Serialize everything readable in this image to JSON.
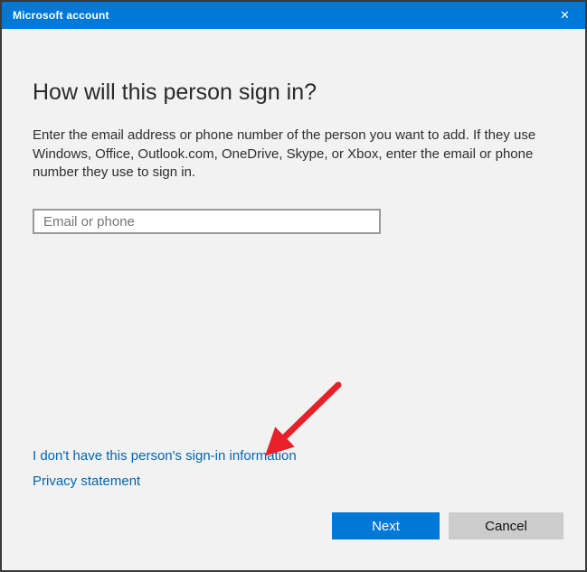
{
  "window": {
    "title": "Microsoft account",
    "close_glyph": "✕"
  },
  "dialog": {
    "heading": "How will this person sign in?",
    "description": "Enter the email address or phone number of the person you want to add. If they use Windows, Office, Outlook.com, OneDrive, Skype, or Xbox, enter the email or phone number they use to sign in.",
    "input": {
      "value": "",
      "placeholder": "Email or phone"
    },
    "links": [
      {
        "label": "I don't have this person's sign-in information"
      },
      {
        "label": "Privacy statement"
      }
    ],
    "buttons": {
      "next": "Next",
      "cancel": "Cancel"
    }
  },
  "annotation": {
    "type": "red-arrow",
    "points_to": "I don't have this person's sign-in information",
    "color": "#e8202a"
  },
  "colors": {
    "titlebar_bg": "#0078d7",
    "titlebar_text": "#ffffff",
    "content_bg": "#f2f2f2",
    "link": "#0066b4",
    "next_button_bg": "#0078d7",
    "cancel_button_bg": "#cccccc",
    "window_border": "#3a3a3a"
  }
}
